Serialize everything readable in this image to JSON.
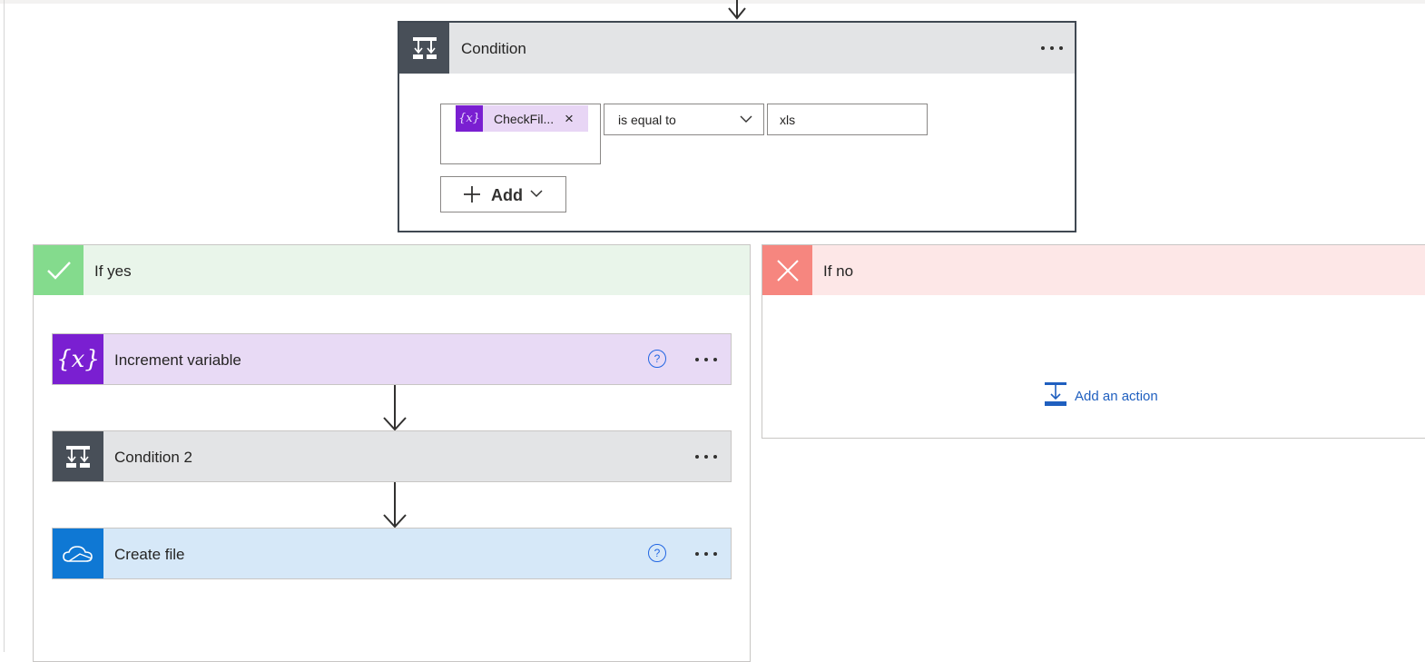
{
  "colors": {
    "condition_tile": "#484f58",
    "variable_tile": "#7a1fd1",
    "onedrive_tile": "#0f78d4",
    "yes_accent": "#84db8d",
    "no_accent": "#f6867f",
    "link": "#1f5fbf"
  },
  "condition": {
    "title": "Condition",
    "icon": "condition-icon",
    "token": {
      "label": "CheckFil...",
      "icon": "variable-icon",
      "remove": "×"
    },
    "operator": "is equal to",
    "value": "xls",
    "add_label": "Add"
  },
  "branches": {
    "yes": {
      "title": "If yes",
      "icon": "check-icon",
      "actions": [
        {
          "title": "Increment variable",
          "icon": "variable-icon"
        },
        {
          "title": "Condition 2",
          "icon": "condition-icon"
        },
        {
          "title": "Create file",
          "icon": "onedrive-icon"
        }
      ]
    },
    "no": {
      "title": "If no",
      "icon": "close-icon",
      "add_action_label": "Add an action"
    }
  },
  "help_glyph": "?"
}
